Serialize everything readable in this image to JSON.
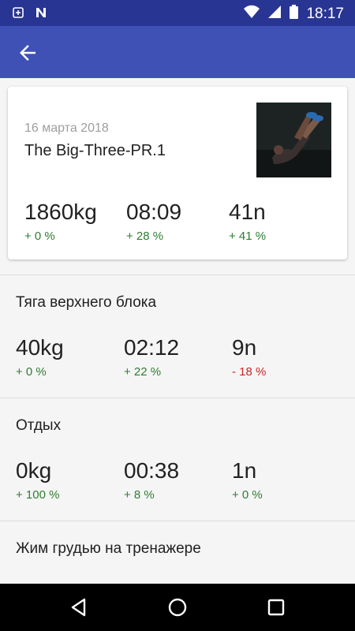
{
  "status_bar": {
    "time": "18:17",
    "icons": [
      "notification-icon",
      "n-app-icon",
      "wifi-icon",
      "signal-icon",
      "battery-icon"
    ]
  },
  "app_bar": {
    "back_icon": "arrow-back-icon"
  },
  "summary": {
    "date": "16 марта 2018",
    "title": "The Big-Three-PR.1",
    "metrics": [
      {
        "value": "1860kg",
        "change": "+ 0 %",
        "trend": "up"
      },
      {
        "value": "08:09",
        "change": "+ 28 %",
        "trend": "up"
      },
      {
        "value": "41n",
        "change": "+ 41 %",
        "trend": "up"
      }
    ]
  },
  "exercises": [
    {
      "name": "Тяга верхнего блока",
      "metrics": [
        {
          "value": "40kg",
          "change": "+ 0 %",
          "trend": "up"
        },
        {
          "value": "02:12",
          "change": "+ 22 %",
          "trend": "up"
        },
        {
          "value": "9n",
          "change": "- 18 %",
          "trend": "down"
        }
      ]
    },
    {
      "name": "Отдых",
      "metrics": [
        {
          "value": "0kg",
          "change": "+ 100 %",
          "trend": "up"
        },
        {
          "value": "00:38",
          "change": "+ 8 %",
          "trend": "up"
        },
        {
          "value": "1n",
          "change": "+ 0 %",
          "trend": "up"
        }
      ]
    },
    {
      "name": "Жим грудью на тренажере"
    }
  ],
  "colors": {
    "status_bar": "#283593",
    "app_bar": "#3f51b5",
    "positive": "#2e7d32",
    "negative": "#c62828"
  },
  "nav_bar": {
    "icons": [
      "back-triangle-icon",
      "home-circle-icon",
      "recents-square-icon"
    ]
  }
}
